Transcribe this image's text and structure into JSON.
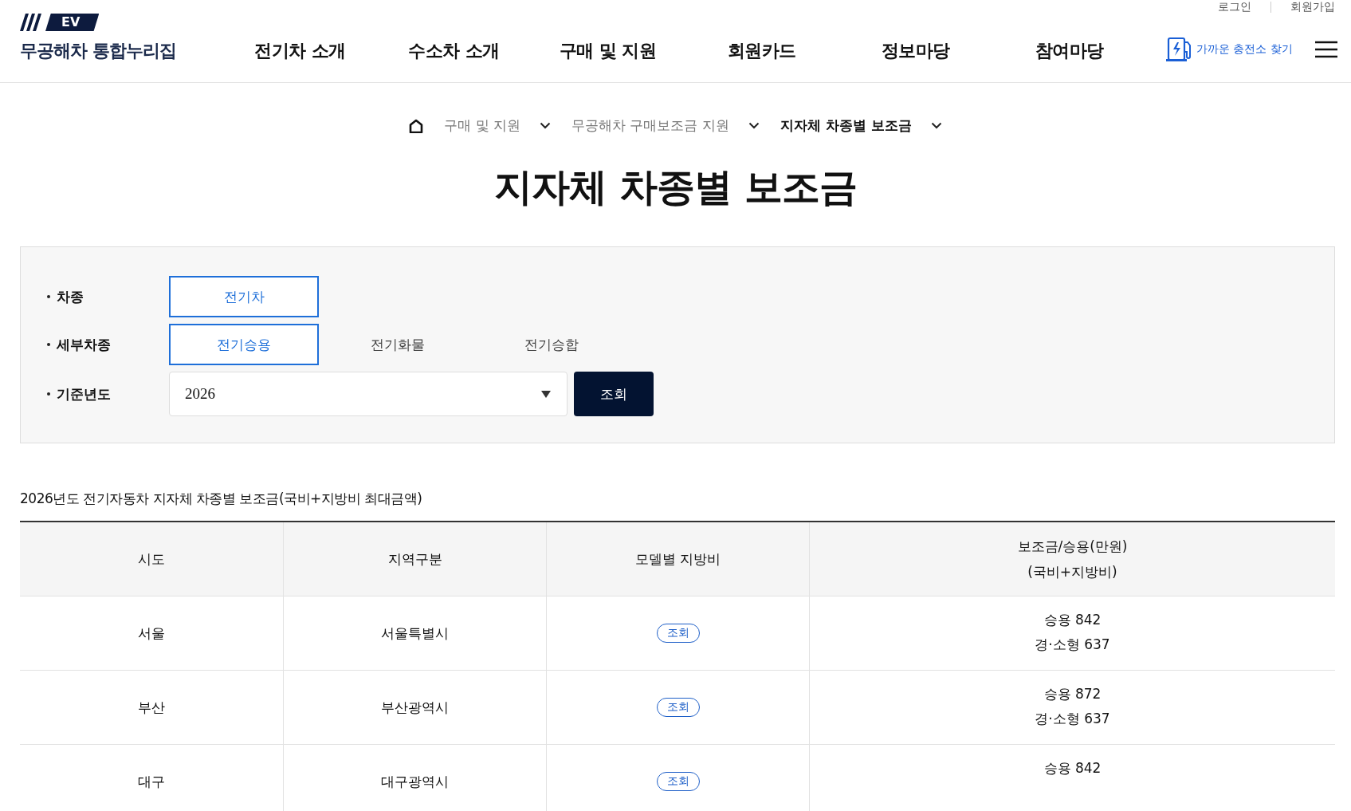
{
  "header": {
    "logo_badge": "EV",
    "site_title": "무공해차 통합누리집",
    "utility_links": [
      "로그인",
      "회원가입"
    ],
    "nav": [
      "전기차 소개",
      "수소차 소개",
      "구매 및 지원",
      "회원카드",
      "정보마당",
      "참여마당"
    ],
    "charger_link": "가까운 충전소 찾기"
  },
  "breadcrumb": [
    {
      "label": "구매 및 지원",
      "current": false
    },
    {
      "label": "무공해차 구매보조금 지원",
      "current": false
    },
    {
      "label": "지자체 차종별 보조금",
      "current": true
    }
  ],
  "page_title": "지자체 차종별 보조금",
  "filter": {
    "rows": [
      {
        "label": "차종",
        "kind": "options",
        "options": [
          {
            "label": "전기차",
            "selected": true
          }
        ]
      },
      {
        "label": "세부차종",
        "kind": "options",
        "options": [
          {
            "label": "전기승용",
            "selected": true
          },
          {
            "label": "전기화물",
            "selected": false
          },
          {
            "label": "전기승합",
            "selected": false
          }
        ]
      },
      {
        "label": "기준년도",
        "kind": "select",
        "value": "2026",
        "button": "조회"
      }
    ]
  },
  "table": {
    "caption": "2026년도 전기자동차 지자체 차종별 보조금(국비+지방비 최대금액)",
    "columns": [
      [
        "시도"
      ],
      [
        "지역구분"
      ],
      [
        "모델별 지방비"
      ],
      [
        "보조금/승용(만원)",
        "(국비+지방비)"
      ]
    ],
    "rows": [
      {
        "sido": "서울",
        "region": "서울특별시",
        "detail_button": "조회",
        "subsidy": [
          "승용 842",
          "경·소형 637"
        ]
      },
      {
        "sido": "부산",
        "region": "부산광역시",
        "detail_button": "조회",
        "subsidy": [
          "승용 872",
          "경·소형 637"
        ]
      },
      {
        "sido": "대구",
        "region": "대구광역시",
        "detail_button": "조회",
        "subsidy": [
          "승용 842"
        ]
      }
    ]
  }
}
